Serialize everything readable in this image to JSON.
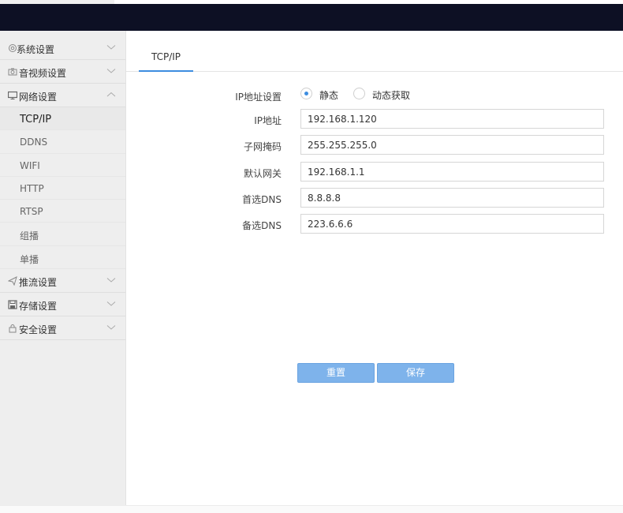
{
  "sidebar": {
    "groups": [
      {
        "label": "系统设置",
        "icon": "gear-icon",
        "chevron": "down"
      },
      {
        "label": "音视频设置",
        "icon": "camera-icon",
        "chevron": "down"
      },
      {
        "label": "网络设置",
        "icon": "monitor-icon",
        "chevron": "up"
      },
      {
        "label": "推流设置",
        "icon": "send-icon",
        "chevron": "down"
      },
      {
        "label": "存储设置",
        "icon": "save-icon",
        "chevron": "down"
      },
      {
        "label": "安全设置",
        "icon": "lock-icon",
        "chevron": "down"
      }
    ],
    "network_items": [
      {
        "label": "TCP/IP",
        "active": true
      },
      {
        "label": "DDNS"
      },
      {
        "label": "WIFI"
      },
      {
        "label": "HTTP"
      },
      {
        "label": "RTSP"
      },
      {
        "label": "组播"
      },
      {
        "label": "单播"
      }
    ]
  },
  "main": {
    "tab": "TCP/IP",
    "ip_mode": {
      "label": "IP地址设置",
      "options": [
        "静态",
        "动态获取"
      ],
      "selected": "静态"
    },
    "fields": [
      {
        "label": "IP地址",
        "value": "192.168.1.120"
      },
      {
        "label": "子网掩码",
        "value": "255.255.255.0"
      },
      {
        "label": "默认网关",
        "value": "192.168.1.1"
      },
      {
        "label": "首选DNS",
        "value": "8.8.8.8"
      },
      {
        "label": "备选DNS",
        "value": "223.6.6.6"
      }
    ],
    "buttons": {
      "reset": "重置",
      "save": "保存"
    }
  },
  "colors": {
    "accent": "#3d8de0",
    "button": "#7eb3eb",
    "topbar": "#0d1024",
    "sidebar": "#eeeeee"
  }
}
